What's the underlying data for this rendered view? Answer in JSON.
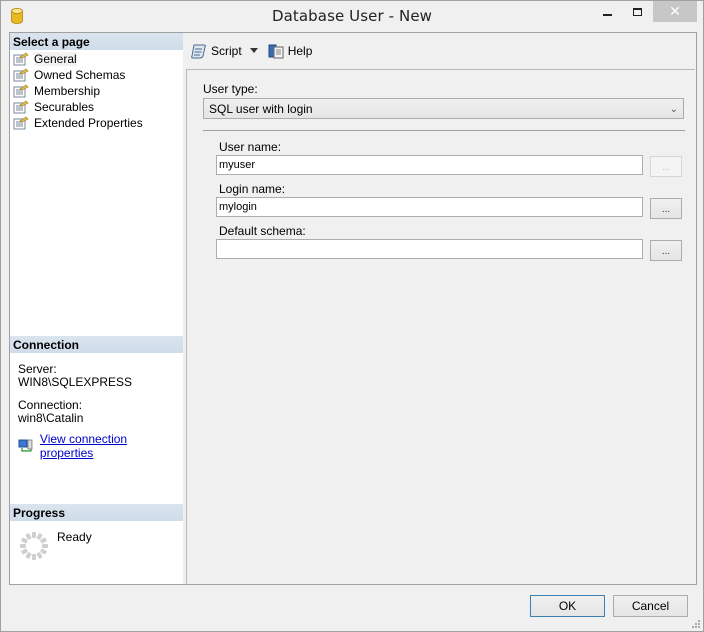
{
  "window": {
    "title": "Database User - New",
    "close_glyph": "✕"
  },
  "left_panel": {
    "select_page_header": "Select a page",
    "pages": [
      {
        "label": "General",
        "selected": true
      },
      {
        "label": "Owned Schemas",
        "selected": false
      },
      {
        "label": "Membership",
        "selected": false
      },
      {
        "label": "Securables",
        "selected": false
      },
      {
        "label": "Extended Properties",
        "selected": false
      }
    ],
    "connection_header": "Connection",
    "server_label": "Server:",
    "server_value": "WIN8\\SQLEXPRESS",
    "connection_label": "Connection:",
    "connection_value": "win8\\Catalin",
    "view_connection_link": "View connection properties",
    "progress_header": "Progress",
    "progress_status": "Ready"
  },
  "toolbar": {
    "script_label": "Script",
    "help_label": "Help"
  },
  "form": {
    "user_type_label": "User type:",
    "user_type_value": "SQL user with login",
    "user_name_label": "User name:",
    "user_name_value": "myuser",
    "login_name_label": "Login name:",
    "login_name_value": "mylogin",
    "default_schema_label": "Default schema:",
    "default_schema_value": "",
    "browse_label": "..."
  },
  "buttons": {
    "ok_label": "OK",
    "cancel_label": "Cancel"
  }
}
